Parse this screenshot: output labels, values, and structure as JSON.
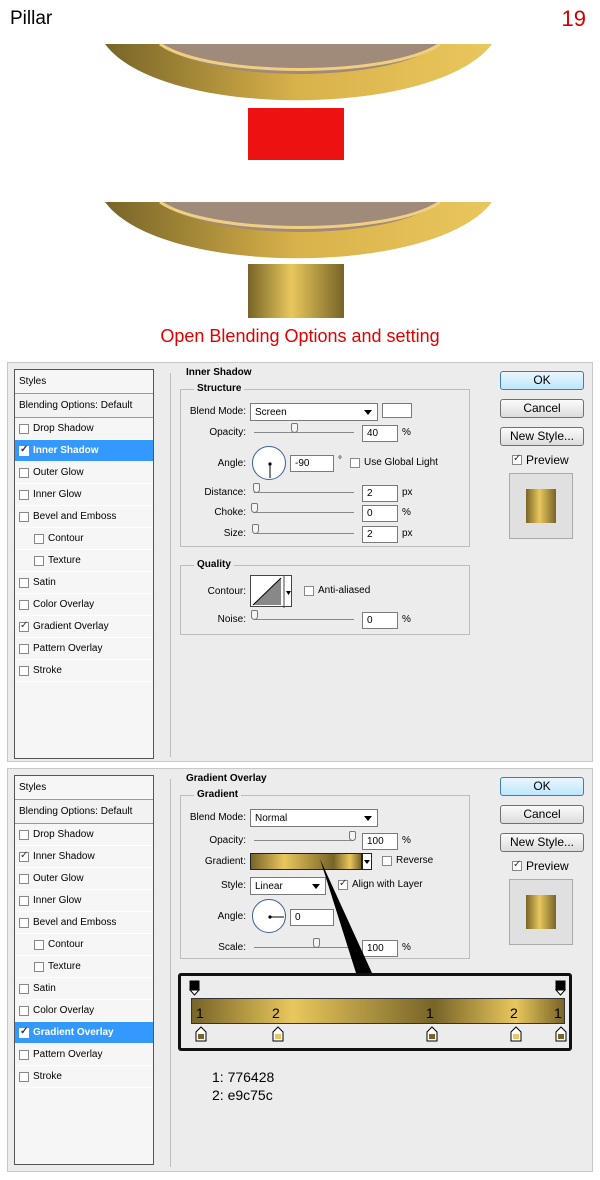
{
  "header": {
    "title": "Pillar",
    "page": "19"
  },
  "caption": "Open Blending Options and setting",
  "colors": {
    "gold_dark": "#776428",
    "gold_light": "#e9c75c",
    "red": "#ee1111",
    "accent": "#3399ff"
  },
  "panel1": {
    "section": "Inner Shadow",
    "group1": "Structure",
    "blend_mode_label": "Blend Mode:",
    "blend_mode": "Screen",
    "opacity_label": "Opacity:",
    "opacity": "40",
    "opacity_unit": "%",
    "angle_label": "Angle:",
    "angle": "-90",
    "angle_unit": "°",
    "global_light": "Use Global Light",
    "distance_label": "Distance:",
    "distance": "2",
    "distance_unit": "px",
    "choke_label": "Choke:",
    "choke": "0",
    "choke_unit": "%",
    "size_label": "Size:",
    "size": "2",
    "size_unit": "px",
    "group2": "Quality",
    "contour_label": "Contour:",
    "anti_aliased": "Anti-aliased",
    "noise_label": "Noise:",
    "noise": "0",
    "noise_unit": "%"
  },
  "panel2": {
    "section": "Gradient Overlay",
    "group1": "Gradient",
    "blend_mode_label": "Blend Mode:",
    "blend_mode": "Normal",
    "opacity_label": "Opacity:",
    "opacity": "100",
    "opacity_unit": "%",
    "gradient_label": "Gradient:",
    "reverse": "Reverse",
    "style_label": "Style:",
    "style": "Linear",
    "align": "Align with Layer",
    "angle_label": "Angle:",
    "angle": "0",
    "scale_label": "Scale:",
    "scale": "100",
    "scale_unit": "%",
    "stop_labels": [
      "1",
      "2",
      "1",
      "2",
      "1"
    ],
    "legend": [
      "1: 776428",
      "2: e9c75c"
    ]
  },
  "styles": {
    "header": "Styles",
    "blending": "Blending Options: Default",
    "items": [
      "Drop Shadow",
      "Inner Shadow",
      "Outer Glow",
      "Inner Glow",
      "Bevel and Emboss",
      "Contour",
      "Texture",
      "Satin",
      "Color Overlay",
      "Gradient Overlay",
      "Pattern Overlay",
      "Stroke"
    ]
  },
  "buttons": {
    "ok": "OK",
    "cancel": "Cancel",
    "new_style": "New Style...",
    "preview": "Preview"
  }
}
